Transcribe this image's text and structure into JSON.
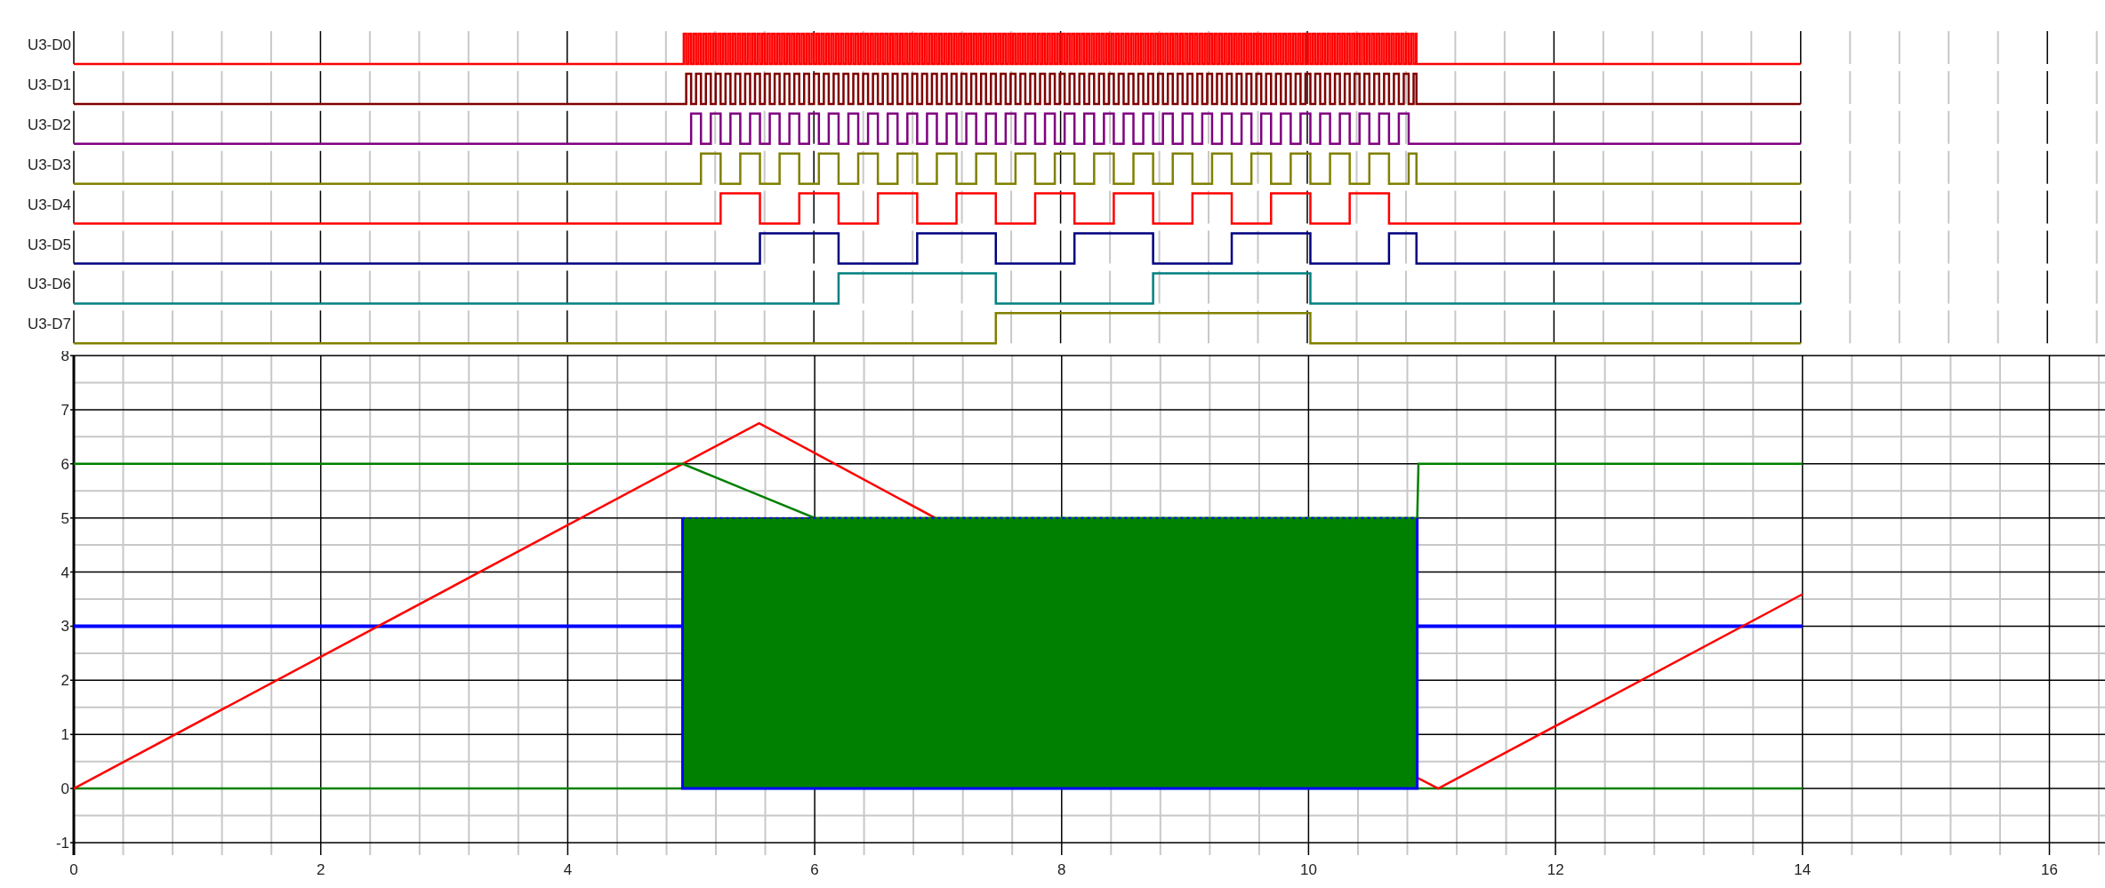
{
  "digital_traces": [
    {
      "label": "U3-D0",
      "color": "#ff0000"
    },
    {
      "label": "U3-D1",
      "color": "#800000"
    },
    {
      "label": "U3-D2",
      "color": "#800080"
    },
    {
      "label": "U3-D3",
      "color": "#808000"
    },
    {
      "label": "U3-D4",
      "color": "#ff0000"
    },
    {
      "label": "U3-D5",
      "color": "#000080"
    },
    {
      "label": "U3-D6",
      "color": "#008080"
    },
    {
      "label": "U3-D7",
      "color": "#808000"
    }
  ],
  "analog_plot": {
    "chart_data": {
      "type": "line",
      "x": [
        0,
        4.93,
        5.55,
        6.0,
        10.88,
        10.89,
        11.05,
        14
      ],
      "series": [
        {
          "color": "#008000",
          "values": [
            0,
            0,
            0,
            0,
            0,
            0,
            0,
            0
          ]
        },
        {
          "color": "#0000ff",
          "values": [
            3,
            3,
            null,
            null,
            null,
            3,
            3,
            3
          ]
        },
        {
          "color": "#ff0000",
          "values": [
            0,
            6.0,
            6.75,
            6.2,
            0.2,
            0.19,
            0,
            3.59
          ]
        },
        {
          "color": "#008000",
          "values": [
            6,
            6,
            5.42,
            5,
            5,
            6,
            6,
            6
          ]
        }
      ],
      "xlim": [
        0,
        16.45
      ],
      "ylim": [
        -1,
        8
      ],
      "xticks": [
        0,
        2,
        4,
        6,
        8,
        10,
        12,
        14,
        16
      ],
      "yticks": [
        -1,
        0,
        1,
        2,
        3,
        4,
        5,
        6,
        7,
        8
      ],
      "grid": true
    }
  }
}
